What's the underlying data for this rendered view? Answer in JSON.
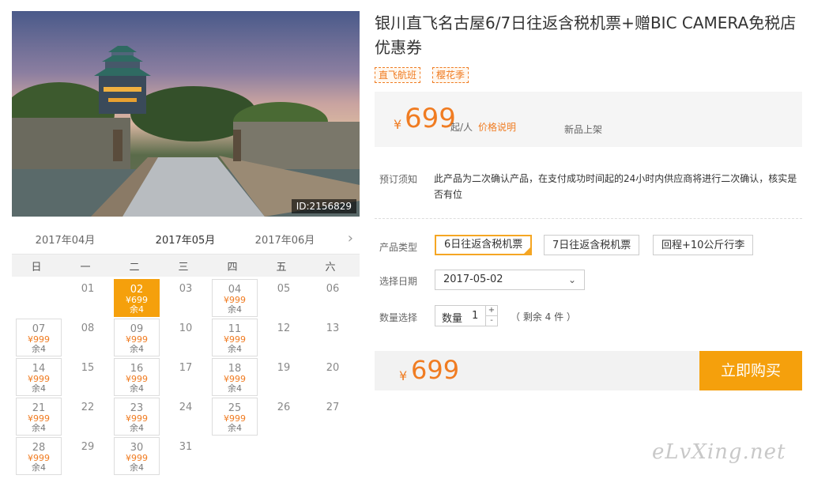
{
  "hero": {
    "image_id": "ID:2156829"
  },
  "product": {
    "title": "银川直飞名古屋6/7日往返含税机票+赠BIC CAMERA免税店优惠券",
    "tags": [
      "直飞航班",
      "樱花季"
    ]
  },
  "price_box": {
    "currency": "¥",
    "price": "699",
    "unit": "起/人",
    "explain_link": "价格说明",
    "status": "新品上架"
  },
  "notice": {
    "label": "预订须知",
    "text": "此产品为二次确认产品，在支付成功时间起的24小时内供应商将进行二次确认，核实是否有位"
  },
  "product_type": {
    "label": "产品类型",
    "options": [
      "6日往返含税机票",
      "7日往返含税机票",
      "回程+10公斤行李"
    ],
    "selected_index": 0
  },
  "date_select": {
    "label": "选择日期",
    "value": "2017-05-02"
  },
  "quantity": {
    "label": "数量选择",
    "field_label": "数量",
    "value": "1",
    "plus": "+",
    "minus": "-",
    "remaining": "（ 剩余 4 件 ）"
  },
  "buy": {
    "currency": "¥",
    "total": "699",
    "button_label": "立即购买"
  },
  "calendar": {
    "months": [
      "2017年04月",
      "2017年05月",
      "2017年06月"
    ],
    "active_month_index": 1,
    "next_icon": "›",
    "weekdays": [
      "日",
      "一",
      "二",
      "三",
      "四",
      "五",
      "六"
    ],
    "weeks": [
      [
        {
          "d": ""
        },
        {
          "d": "01"
        },
        {
          "d": "02",
          "p": "¥699",
          "s": "余4",
          "sel": true
        },
        {
          "d": "03"
        },
        {
          "d": "04",
          "p": "¥999",
          "s": "余4"
        },
        {
          "d": "05"
        },
        {
          "d": "06"
        }
      ],
      [
        {
          "d": "07",
          "p": "¥999",
          "s": "余4"
        },
        {
          "d": "08"
        },
        {
          "d": "09",
          "p": "¥999",
          "s": "余4"
        },
        {
          "d": "10"
        },
        {
          "d": "11",
          "p": "¥999",
          "s": "余4"
        },
        {
          "d": "12"
        },
        {
          "d": "13"
        }
      ],
      [
        {
          "d": "14",
          "p": "¥999",
          "s": "余4"
        },
        {
          "d": "15"
        },
        {
          "d": "16",
          "p": "¥999",
          "s": "余4"
        },
        {
          "d": "17"
        },
        {
          "d": "18",
          "p": "¥999",
          "s": "余4"
        },
        {
          "d": "19"
        },
        {
          "d": "20"
        }
      ],
      [
        {
          "d": "21",
          "p": "¥999",
          "s": "余4"
        },
        {
          "d": "22"
        },
        {
          "d": "23",
          "p": "¥999",
          "s": "余4"
        },
        {
          "d": "24"
        },
        {
          "d": "25",
          "p": "¥999",
          "s": "余4"
        },
        {
          "d": "26"
        },
        {
          "d": "27"
        }
      ],
      [
        {
          "d": "28",
          "p": "¥999",
          "s": "余4"
        },
        {
          "d": "29"
        },
        {
          "d": "30",
          "p": "¥999",
          "s": "余4"
        },
        {
          "d": "31"
        },
        {
          "d": ""
        },
        {
          "d": ""
        },
        {
          "d": ""
        }
      ]
    ]
  },
  "watermark": "eLvXing.net",
  "colors": {
    "accent": "#f5a00c",
    "price": "#f07c22"
  }
}
